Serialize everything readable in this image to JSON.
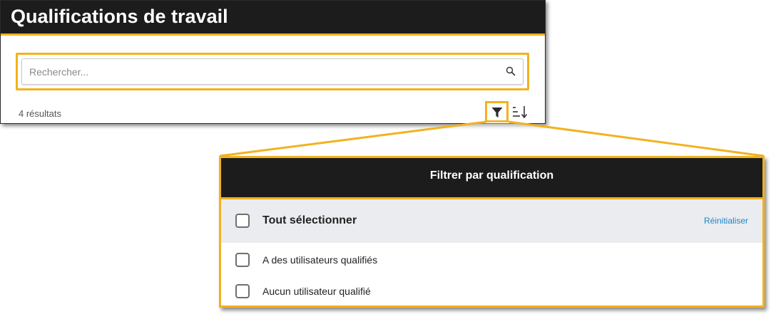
{
  "header": {
    "title": "Qualifications de travail"
  },
  "search": {
    "placeholder": "Rechercher...",
    "value": ""
  },
  "results": {
    "count_text": "4 résultats"
  },
  "toolbar": {
    "filter_icon": "filter-icon",
    "sort_icon": "sort-icon"
  },
  "filter_panel": {
    "title": "Filtrer par qualification",
    "select_all_label": "Tout sélectionner",
    "reset_label": "Réinitialiser",
    "options": [
      {
        "label": "A des utilisateurs qualifiés",
        "checked": false
      },
      {
        "label": "Aucun utilisateur qualifié",
        "checked": false
      }
    ]
  },
  "colors": {
    "header_bg": "#1c1c1c",
    "highlight": "#f2b21e",
    "link": "#1a86c8",
    "select_all_bg": "#eaecef"
  }
}
